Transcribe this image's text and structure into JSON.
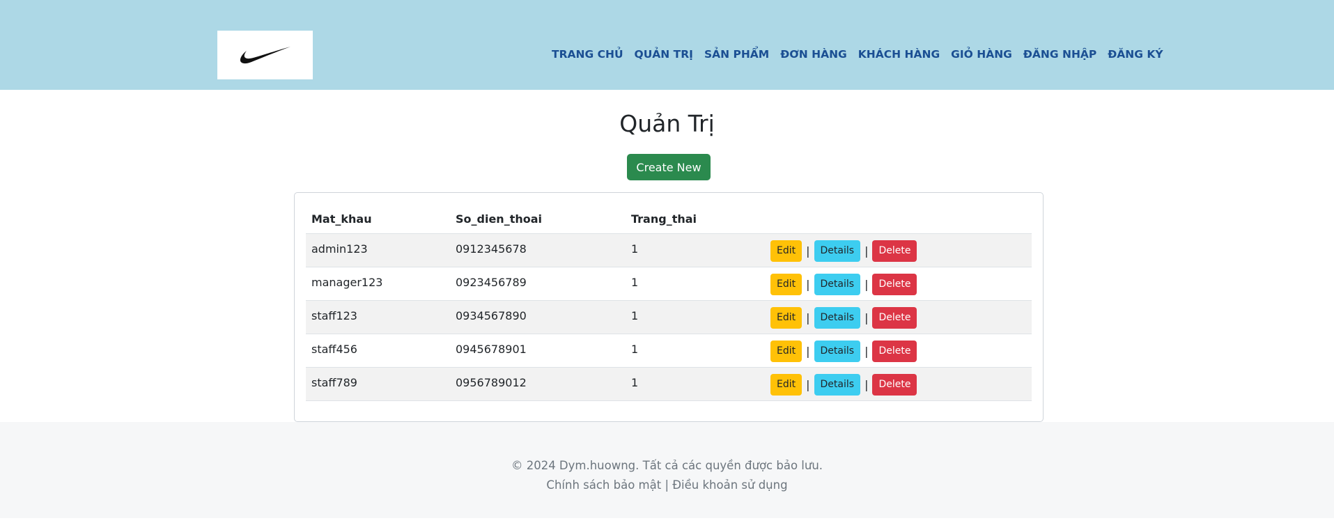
{
  "header": {
    "background": "#add8e6",
    "nav": [
      "TRANG CHỦ",
      "QUẢN TRỊ",
      "SẢN PHẨM",
      "ĐƠN HÀNG",
      "KHÁCH HÀNG",
      "GIỎ HÀNG",
      "ĐĂNG NHẬP",
      "ĐĂNG KÝ"
    ]
  },
  "main": {
    "title": "Quản Trị",
    "create_label": "Create New",
    "table": {
      "headers": [
        "Mat_khau",
        "So_dien_thoai",
        "Trang_thai",
        ""
      ],
      "rows": [
        {
          "mat_khau": "admin123",
          "so_dien_thoai": "0912345678",
          "trang_thai": "1"
        },
        {
          "mat_khau": "manager123",
          "so_dien_thoai": "0923456789",
          "trang_thai": "1"
        },
        {
          "mat_khau": "staff123",
          "so_dien_thoai": "0934567890",
          "trang_thai": "1"
        },
        {
          "mat_khau": "staff456",
          "so_dien_thoai": "0945678901",
          "trang_thai": "1"
        },
        {
          "mat_khau": "staff789",
          "so_dien_thoai": "0956789012",
          "trang_thai": "1"
        }
      ],
      "actions": {
        "edit": "Edit",
        "details": "Details",
        "delete": "Delete",
        "separator": "|"
      }
    }
  },
  "footer": {
    "copyright": "© 2024 Dym.huowng. Tất cả các quyền được bảo lưu.",
    "links": "Chính sách bảo mật | Điều khoản sử dụng"
  },
  "colors": {
    "header_bg": "#add8e6",
    "nav_text": "#1b4f93",
    "create_btn": "#2b8a4e",
    "edit_btn": "#ffc107",
    "details_btn": "#3dcdf0",
    "delete_btn": "#dc3545"
  }
}
